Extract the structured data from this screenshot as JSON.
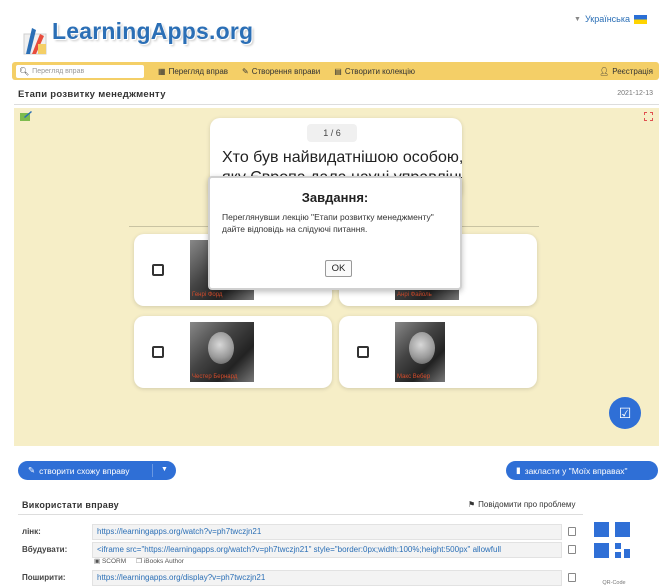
{
  "header": {
    "logo_text": "LearningApps.org",
    "language": "Українська",
    "language_flag_colors": [
      "#2a6fd6",
      "#ffd400"
    ]
  },
  "navbar": {
    "search_placeholder": "Перегляд вправ",
    "items": [
      {
        "label": "Перегляд вправ",
        "icon": "grid-icon"
      },
      {
        "label": "Створення вправи",
        "icon": "pencil-icon"
      },
      {
        "label": "Створити колекцію",
        "icon": "collection-icon"
      }
    ],
    "register_label": "Реєстрація",
    "background_color": "#f4cf67"
  },
  "page": {
    "title": "Етапи розвитку менеджменту",
    "date": "2021-12-13"
  },
  "app": {
    "background_color": "#f6eec7",
    "counter": "1 / 6",
    "question": "Хто був найвидатнішою особою,",
    "question_line2": "яку Європа дала науці управління",
    "answers": [
      {
        "caption": "Генрі Форд"
      },
      {
        "caption": "Анрі Файоль"
      },
      {
        "caption": "Честер Бернард"
      },
      {
        "caption": "Макс Вебер"
      }
    ]
  },
  "modal": {
    "title": "Завдання:",
    "body": "Переглянувши лекцію \"Етапи розвитку менеджменту\" дайте відповідь на слідуючі питання.",
    "ok_label": "OK"
  },
  "actions": {
    "create_similar": "створити схожу вправу",
    "bookmark": "закласти у \"Моїх вправах\"",
    "accent_color": "#2f6fd6"
  },
  "use": {
    "title": "Використати вправу",
    "report": "Повідомити про проблему",
    "rows": [
      {
        "label": "лінк:",
        "value": "https://learningapps.org/watch?v=ph7twczjn21"
      },
      {
        "label": "Вбудувати:",
        "value": "<iframe src=\"https://learningapps.org/watch?v=ph7twczjn21\" style=\"border:0px;width:100%;height:500px\" allowfull"
      },
      {
        "label": "Поширити:",
        "value": "https://learningapps.org/display?v=ph7twczjn21"
      }
    ],
    "scorm": "SCORM",
    "ibooks": "iBooks Author",
    "qr_label": "QR-Code"
  }
}
